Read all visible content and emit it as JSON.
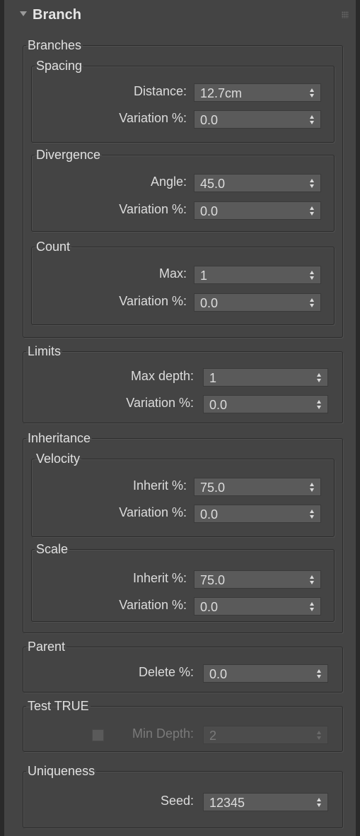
{
  "rollout": {
    "title": "Branch"
  },
  "branches": {
    "legend": "Branches",
    "spacing": {
      "legend": "Spacing",
      "distance_label": "Distance:",
      "distance_value": "12.7cm",
      "variation_label": "Variation %:",
      "variation_value": "0.0"
    },
    "divergence": {
      "legend": "Divergence",
      "angle_label": "Angle:",
      "angle_value": "45.0",
      "variation_label": "Variation %:",
      "variation_value": "0.0"
    },
    "count": {
      "legend": "Count",
      "max_label": "Max:",
      "max_value": "1",
      "variation_label": "Variation %:",
      "variation_value": "0.0"
    }
  },
  "limits": {
    "legend": "Limits",
    "max_depth_label": "Max depth:",
    "max_depth_value": "1",
    "variation_label": "Variation %:",
    "variation_value": "0.0"
  },
  "inheritance": {
    "legend": "Inheritance",
    "velocity": {
      "legend": "Velocity",
      "inherit_label": "Inherit %:",
      "inherit_value": "75.0",
      "variation_label": "Variation %:",
      "variation_value": "0.0"
    },
    "scale": {
      "legend": "Scale",
      "inherit_label": "Inherit %:",
      "inherit_value": "75.0",
      "variation_label": "Variation %:",
      "variation_value": "0.0"
    }
  },
  "parent": {
    "legend": "Parent",
    "delete_label": "Delete %:",
    "delete_value": "0.0"
  },
  "test_true": {
    "legend": "Test TRUE",
    "checked": false,
    "min_depth_label": "Min Depth:",
    "min_depth_value": "2"
  },
  "uniqueness": {
    "legend": "Uniqueness",
    "seed_label": "Seed:",
    "seed_value": "12345"
  },
  "colors": {
    "background": "#444444",
    "spinner": "#5a5a5a",
    "text": "#dcdcdc"
  },
  "icons": {
    "collapse": "triangle-down-icon",
    "grip": "grip-dots-icon",
    "spinner": "spinner-arrows-icon"
  }
}
